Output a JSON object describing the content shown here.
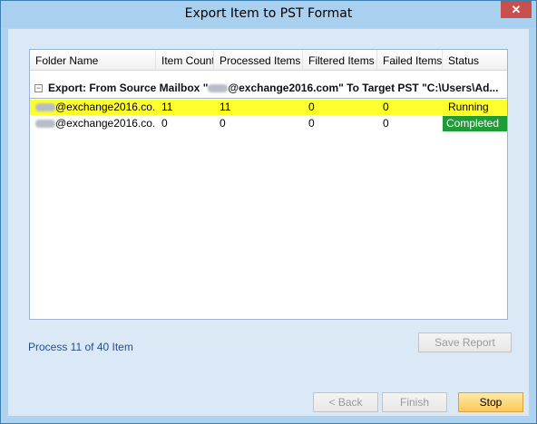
{
  "window": {
    "title": "Export Item to PST Format",
    "close_glyph": "✕"
  },
  "grid": {
    "columns": [
      "Folder Name",
      "Item Count",
      "Processed Items",
      "Filtered Items",
      "Failed Items",
      "Status"
    ],
    "group": {
      "toggle": "−",
      "text_before": "Export: From Source Mailbox \"",
      "text_after": "@exchange2016.com\" To Target PST \"C:\\Users\\Ad..."
    },
    "rows": [
      {
        "folder": "@exchange2016.co...",
        "item_count": "11",
        "processed": "11",
        "filtered": "0",
        "failed": "0",
        "status": "Running",
        "status_color": "#ffff2e"
      },
      {
        "folder": "@exchange2016.co...",
        "item_count": "0",
        "processed": "0",
        "filtered": "0",
        "failed": "0",
        "status": "Completed",
        "status_color": "#1e9c35"
      }
    ]
  },
  "progress_text": "Process 11 of 40 Item",
  "buttons": {
    "save_report": "Save Report",
    "back": "< Back",
    "finish": "Finish",
    "stop": "Stop"
  },
  "colors": {
    "accent_yellow": "#ffff2e",
    "completed_green": "#1e9c35",
    "link_blue": "#1f4e99"
  }
}
